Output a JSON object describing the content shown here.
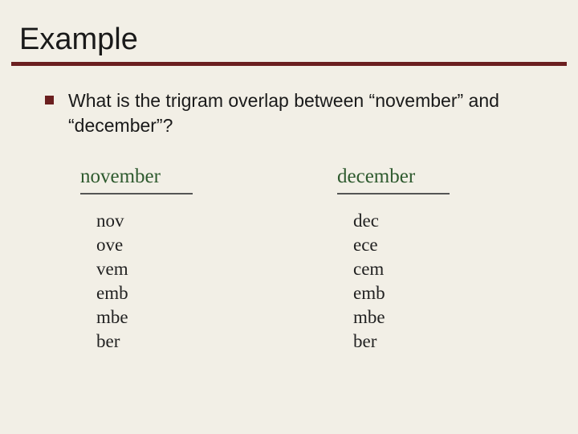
{
  "title": "Example",
  "bullet": "What is the trigram overlap between “november” and “december”?",
  "left": {
    "heading": "november",
    "trigrams": [
      "nov",
      "ove",
      "vem",
      "emb",
      "mbe",
      "ber"
    ]
  },
  "right": {
    "heading": "december",
    "trigrams": [
      "dec",
      "ece",
      "cem",
      "emb",
      "mbe",
      "ber"
    ]
  }
}
